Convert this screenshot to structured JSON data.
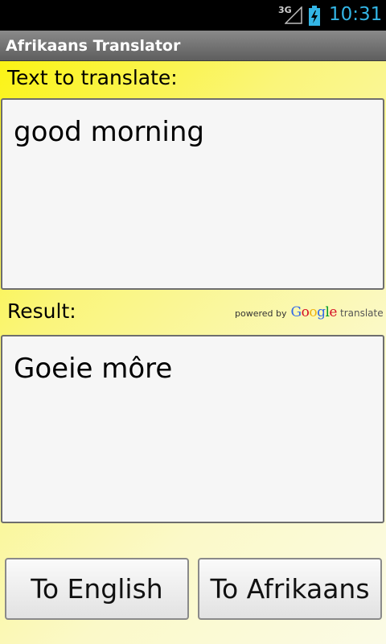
{
  "status_bar": {
    "network": "3G",
    "time": "10:31",
    "icons": [
      "signal-icon",
      "battery-charging-icon"
    ]
  },
  "app": {
    "title": "Afrikaans Translator"
  },
  "input": {
    "label": "Text to translate:",
    "value": "good morning"
  },
  "result": {
    "label": "Result:",
    "value": "Goeie môre",
    "attribution": {
      "powered_by": "powered by",
      "logo_text": "Google",
      "product": "translate"
    }
  },
  "buttons": {
    "to_english": "To English",
    "to_afrikaans": "To Afrikaans"
  },
  "colors": {
    "background_accent": "#fbf300",
    "status_clock": "#33b5e5",
    "titlebar": "#6e6e6e"
  }
}
